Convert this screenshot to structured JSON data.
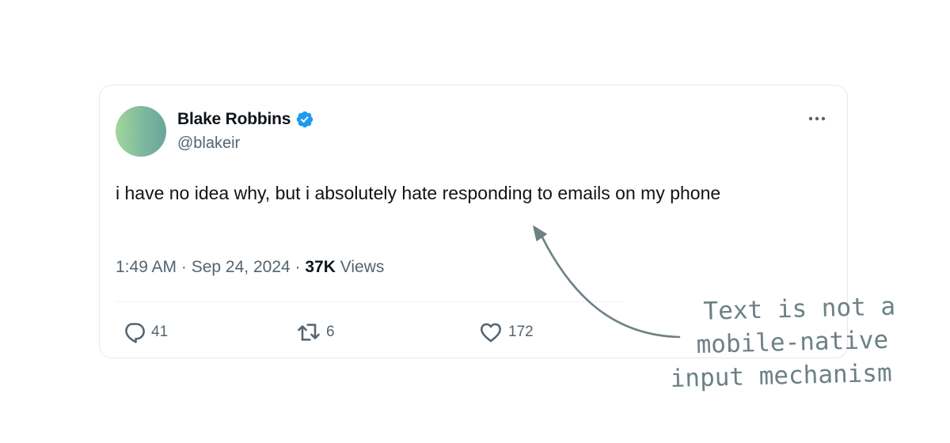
{
  "tweet": {
    "author": {
      "display_name": "Blake Robbins",
      "handle": "@blakeir",
      "verified_icon": "verified-badge-icon",
      "avatar_colors": [
        "#a3d69a",
        "#6aa69a"
      ]
    },
    "text": "i have no idea why, but i absolutely hate responding to emails on my phone",
    "time": "1:49 AM",
    "date": "Sep 24, 2024",
    "separator": "·",
    "views_count": "37K",
    "views_label": "Views",
    "more_icon": "more-options-icon",
    "actions": {
      "replies": "41",
      "retweets": "6",
      "likes": "172"
    }
  },
  "annotation": {
    "lines": [
      "Text is not a",
      "mobile-native",
      "input mechanism"
    ],
    "color": "#6d8185"
  },
  "colors": {
    "verified": "#1d9bf0",
    "text_primary": "#0f1419",
    "text_secondary": "#536471",
    "border": "#e4e8eb"
  }
}
